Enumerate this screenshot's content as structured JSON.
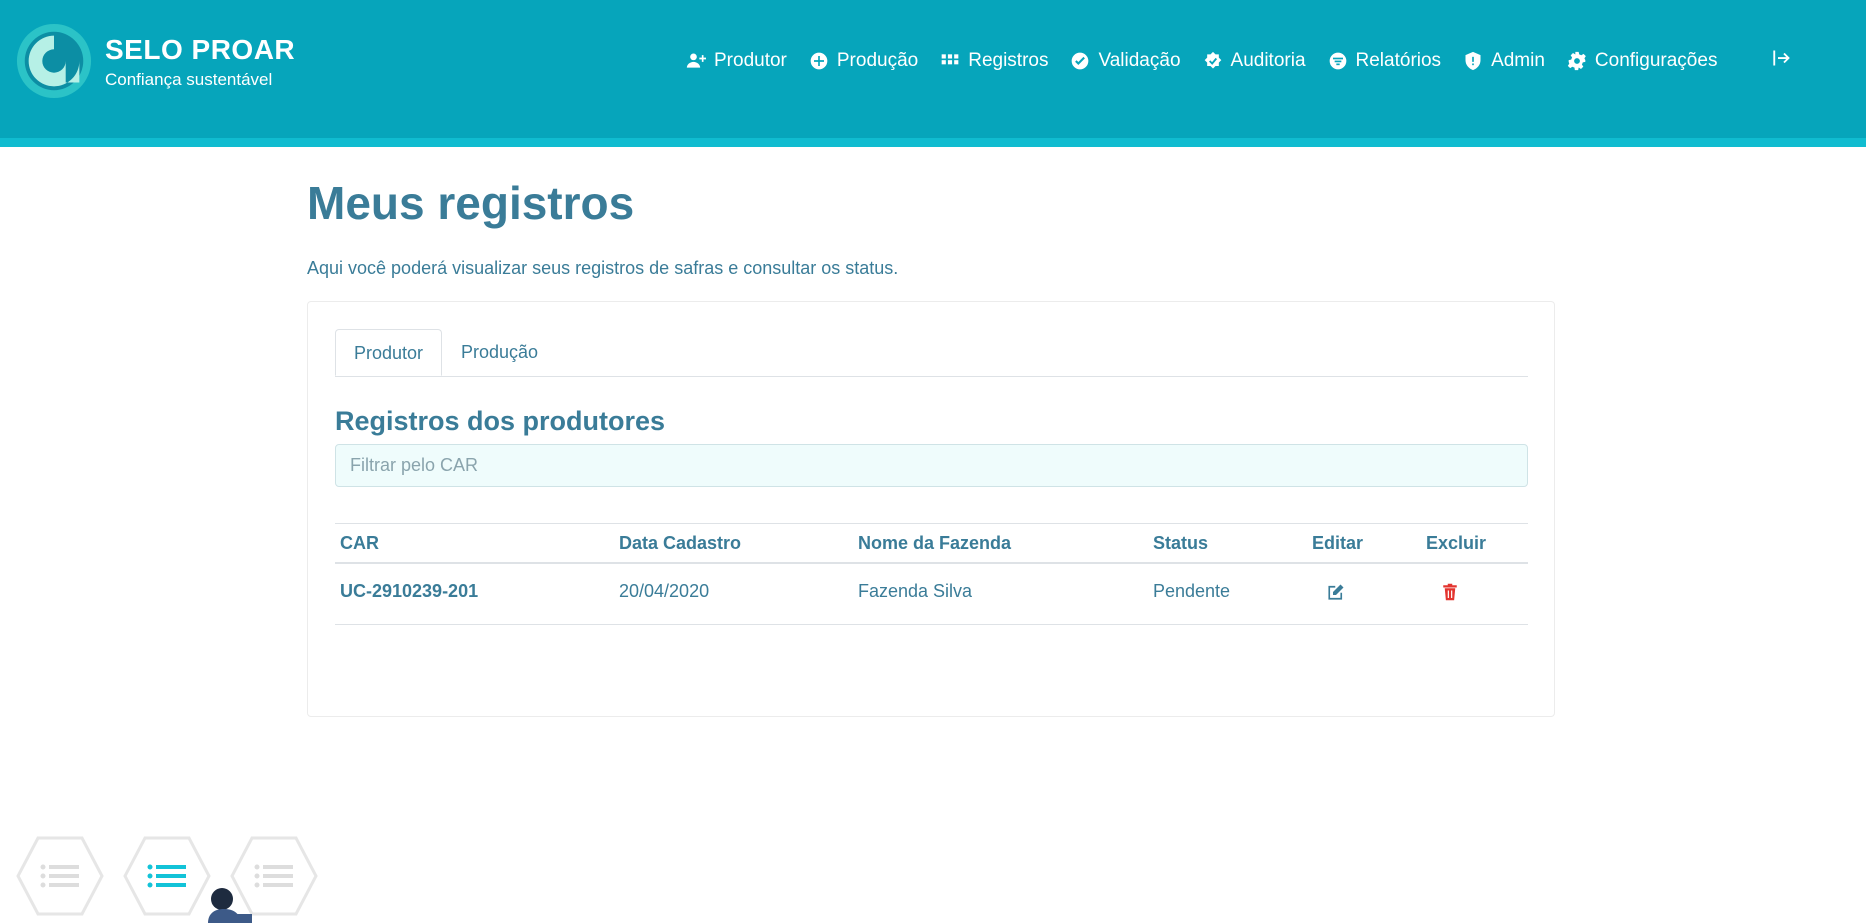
{
  "brand": {
    "title": "SELO PROAR",
    "subtitle": "Confiança sustentável"
  },
  "nav": {
    "items": [
      {
        "label": "Produtor",
        "icon": "user-plus-icon"
      },
      {
        "label": "Produção",
        "icon": "plus-circle-icon"
      },
      {
        "label": "Registros",
        "icon": "grid-icon"
      },
      {
        "label": "Validação",
        "icon": "check-circle-icon"
      },
      {
        "label": "Auditoria",
        "icon": "badge-check-icon"
      },
      {
        "label": "Relatórios",
        "icon": "filter-circle-icon"
      },
      {
        "label": "Admin",
        "icon": "shield-icon"
      },
      {
        "label": "Configurações",
        "icon": "gear-icon"
      }
    ],
    "logout_icon": "logout-icon"
  },
  "page": {
    "title": "Meus registros",
    "description": "Aqui você poderá visualizar seus registros de safras e consultar os status."
  },
  "tabs": [
    {
      "label": "Produtor",
      "active": true
    },
    {
      "label": "Produção",
      "active": false
    }
  ],
  "section": {
    "title": "Registros dos produtores",
    "filter_placeholder": "Filtrar pelo CAR",
    "filter_value": ""
  },
  "table": {
    "columns": [
      "CAR",
      "Data Cadastro",
      "Nome da Fazenda",
      "Status",
      "Editar",
      "Excluir"
    ],
    "rows": [
      {
        "car": "UC-2910239-201",
        "date": "20/04/2020",
        "farm": "Fazenda Silva",
        "status": "Pendente",
        "edit_icon": "edit-icon",
        "delete_icon": "trash-icon"
      }
    ]
  },
  "colors": {
    "header": "#06a5bb",
    "accent_text": "#3a7c98",
    "delete": "#e3342f",
    "filter_bg": "#effcfc"
  },
  "steps": {
    "icons": [
      "list-icon",
      "list-icon",
      "list-icon"
    ],
    "active_index": 1
  }
}
